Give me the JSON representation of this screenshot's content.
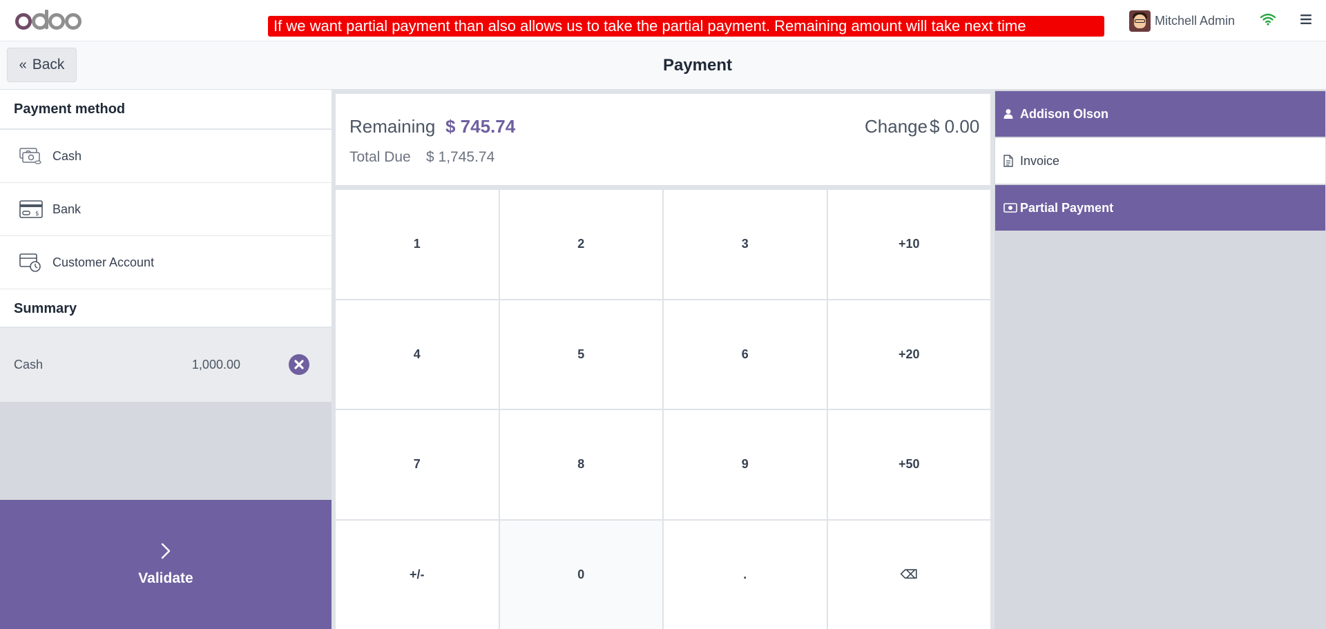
{
  "topbar": {
    "logo": "odoo",
    "banner_text": "If we want partial payment than also allows us to take the partial payment. Remaining amount will take next time",
    "user_name": "Mitchell Admin",
    "icons": {
      "wifi": "wifi-icon",
      "menu": "hamburger-menu-icon"
    }
  },
  "header": {
    "back_label": "Back",
    "title": "Payment"
  },
  "payment_methods": {
    "title": "Payment method",
    "items": [
      {
        "label": "Cash",
        "icon": "cash-icon"
      },
      {
        "label": "Bank",
        "icon": "bank-card-icon"
      },
      {
        "label": "Customer Account",
        "icon": "customer-account-icon"
      }
    ]
  },
  "summary": {
    "title": "Summary",
    "lines": [
      {
        "method": "Cash",
        "amount": "1,000.00"
      }
    ]
  },
  "validate": {
    "label": "Validate"
  },
  "status": {
    "remaining_label": "Remaining",
    "remaining_value": "$ 745.74",
    "change_label": "Change",
    "change_value": "$ 0.00",
    "total_due_label": "Total Due",
    "total_due_value": "$ 1,745.74"
  },
  "numpad": {
    "keys": [
      "1",
      "2",
      "3",
      "+10",
      "4",
      "5",
      "6",
      "+20",
      "7",
      "8",
      "9",
      "+50",
      "+/-",
      "0",
      ".",
      "⌫"
    ]
  },
  "right_panel": {
    "customer": "Addison Olson",
    "invoice": "Invoice",
    "partial_payment": "Partial Payment"
  },
  "colors": {
    "accent": "#6f61a1",
    "banner": "#f20000",
    "logo": "#714b67"
  }
}
